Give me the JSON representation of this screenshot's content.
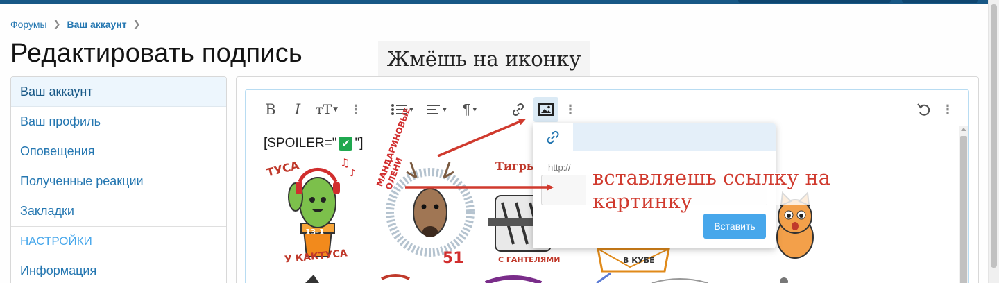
{
  "breadcrumb": {
    "items": [
      "Форумы",
      "Ваш аккаунт"
    ]
  },
  "page": {
    "title": "Редактировать подпись"
  },
  "annotations": {
    "top": "Жмёшь на иконку",
    "right": "вставляешь ссылку на картинку",
    "color": "#d03a2e"
  },
  "sidebar": {
    "items": [
      {
        "label": "Ваш аккаунт",
        "selected": true
      },
      {
        "label": "Ваш профиль"
      },
      {
        "label": "Оповещения"
      },
      {
        "label": "Полученные реакции"
      },
      {
        "label": "Закладки"
      }
    ],
    "section_header": "НАСТРОЙКИ",
    "section_items": [
      {
        "label": "Информация"
      }
    ]
  },
  "toolbar": {
    "buttons": [
      "bold-icon",
      "italic-icon",
      "text-size-icon",
      "more-icon",
      "list-icon",
      "align-icon",
      "paragraph-icon",
      "link-icon",
      "image-icon",
      "more-icon",
      "undo-icon",
      "more-icon"
    ],
    "active": "image-icon",
    "accent": "#2577b1"
  },
  "editor": {
    "spoiler_prefix": "[SPOILER=\"",
    "spoiler_emoji": "✅",
    "spoiler_suffix": "\"]"
  },
  "stickers": {
    "cactus": {
      "top_text": "ТУСА",
      "bottom_text": "У КАКТУСА",
      "badge": "13-1"
    },
    "deer": {
      "text": "МАНДАРИНОВЫЕ ОЛЕНИ",
      "number": "51"
    },
    "tigers": {
      "top_text": "Тигры",
      "bottom_text": "С ГАНТЕЛЯМИ"
    },
    "box": {
      "text": "В КУБЕ"
    }
  },
  "popup": {
    "url_label": "http://",
    "url_value": "",
    "insert_label": "Вставить"
  },
  "colors": {
    "topbar": "#185886",
    "link": "#2577b1",
    "button": "#47a7eb"
  }
}
